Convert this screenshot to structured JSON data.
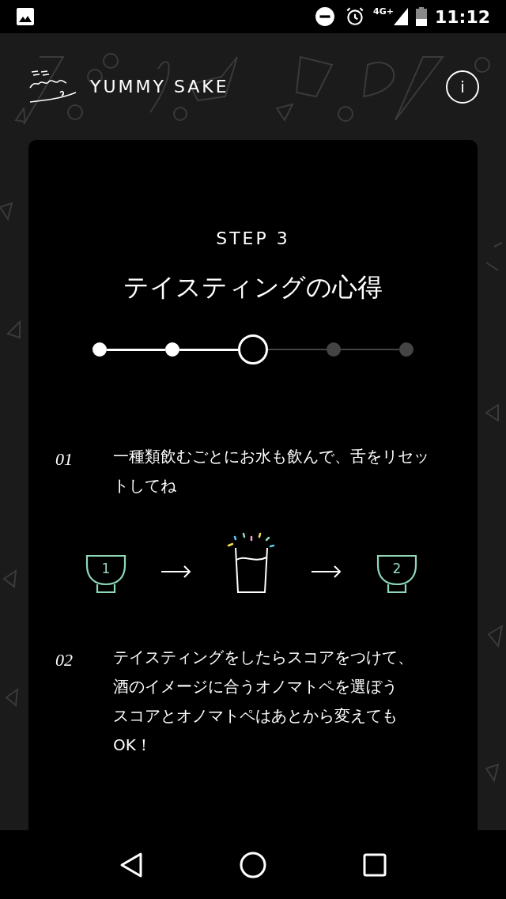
{
  "status_bar": {
    "network": "4G+",
    "time": "11:12"
  },
  "header": {
    "app_name": "YUMMY SAKE",
    "info_button": "i"
  },
  "card": {
    "step_label": "STEP 3",
    "title": "テイスティングの心得",
    "stepper": [
      {
        "kind": "done"
      },
      {
        "kind": "done"
      },
      {
        "kind": "current"
      },
      {
        "kind": "todo"
      },
      {
        "kind": "todo"
      }
    ],
    "tips": [
      {
        "number": "01",
        "lines": [
          "一種類飲むごとにお水も飲んで、舌をリセッ",
          "トしてね"
        ],
        "diagram": {
          "first_cup": "1",
          "second_cup": "2"
        }
      },
      {
        "number": "02",
        "lines": [
          "テイスティングをしたらスコアをつけて、",
          "酒のイメージに合うオノマトペを選ぼう",
          "スコアとオノマトペはあとから変えても",
          "OK！"
        ]
      }
    ]
  }
}
